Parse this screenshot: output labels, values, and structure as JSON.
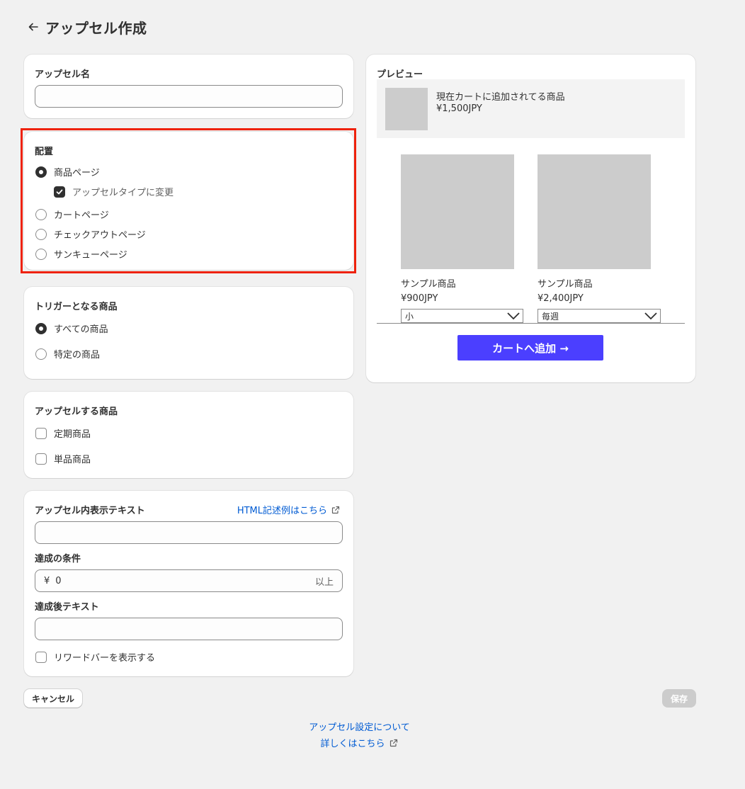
{
  "header": {
    "title": "アップセル作成",
    "back_icon": "arrow-left-icon"
  },
  "name_card": {
    "title": "アップセル名",
    "value": ""
  },
  "placement": {
    "title": "配置",
    "options": [
      {
        "label": "商品ページ",
        "selected": true
      },
      {
        "label": "カートページ",
        "selected": false
      },
      {
        "label": "チェックアウトページ",
        "selected": false
      },
      {
        "label": "サンキューページ",
        "selected": false
      }
    ],
    "sub_checkbox": {
      "label": "アップセルタイプに変更",
      "checked": true
    },
    "highlight_color": "#ee220c"
  },
  "trigger": {
    "title": "トリガーとなる商品",
    "options": [
      {
        "label": "すべての商品",
        "selected": true
      },
      {
        "label": "特定の商品",
        "selected": false
      }
    ]
  },
  "upsell_products": {
    "title": "アップセルする商品",
    "options": [
      {
        "label": "定期商品",
        "checked": false
      },
      {
        "label": "単品商品",
        "checked": false
      }
    ]
  },
  "display_text": {
    "title": "アップセル内表示テキスト",
    "html_link": "HTML記述例はこちら",
    "text_value": "",
    "condition_title": "達成の条件",
    "condition_prefix": "¥",
    "condition_value": "0",
    "condition_suffix": "以上",
    "after_title": "達成後テキスト",
    "after_value": "",
    "reward_bar_label": "リワードバーを表示する",
    "reward_bar_checked": false
  },
  "preview": {
    "title": "プレビュー",
    "current_item": {
      "label": "現在カートに追加されてる商品",
      "price": "¥1,500JPY"
    },
    "products": [
      {
        "name": "サンプル商品",
        "price": "¥900JPY",
        "select": "小"
      },
      {
        "name": "サンプル商品",
        "price": "¥2,400JPY",
        "select": "毎週"
      }
    ],
    "add_button": "カートへ追加 →",
    "button_color": "#4b3fff"
  },
  "actions": {
    "cancel": "キャンセル",
    "save": "保存"
  },
  "footer": {
    "about": "アップセル設定について",
    "details": "詳しくはこちら"
  },
  "colors": {
    "link": "#005bd3",
    "background": "#f1f1f1"
  }
}
